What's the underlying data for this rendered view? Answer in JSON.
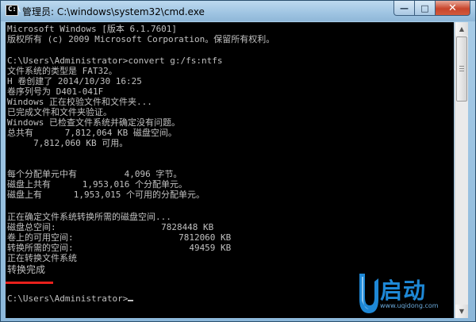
{
  "window": {
    "title": "管理员: C:\\windows\\system32\\cmd.exe",
    "app_icon": "command-prompt-icon",
    "buttons": {
      "minimize": "minimize-icon",
      "maximize": "maximize-icon",
      "close": "close-icon"
    }
  },
  "console": {
    "lines": [
      "Microsoft Windows [版本 6.1.7601]",
      "版权所有 (c) 2009 Microsoft Corporation。保留所有权利。",
      "",
      "C:\\Users\\Administrator>convert g:/fs:ntfs",
      "文件系统的类型是 FAT32。",
      "H 卷创建了 2014/10/30 16:25",
      "卷序列号为 D401-041F",
      "Windows 正在校验文件和文件夹...",
      "已完成文件和文件夹验证。",
      "Windows 已检查文件系统并确定没有问题。",
      "总共有      7,812,064 KB 磁盘空间。",
      "     7,812,060 KB 可用。",
      "",
      "",
      "每个分配单元中有         4,096 字节。",
      "磁盘上共有      1,953,016 个分配单元。",
      "磁盘上有      1,953,015 个可用的分配单元。",
      "",
      "正在确定文件系统转换所需的磁盘空间...",
      "磁盘总空间:                    7828448 KB",
      "卷上的可用空间:                    7812060 KB",
      "转换所需的空间:                      49459 KB",
      "正在转换文件系统",
      "转换完成",
      "",
      "C:\\Users\\Administrator>"
    ]
  },
  "watermark": {
    "brand_cn": "启动",
    "url": "www.uqidong.com",
    "letter": "U"
  },
  "colors": {
    "console_bg": "#000000",
    "console_fg": "#c0c0c0",
    "highlight_underline": "#e8201c",
    "logo_blue": "#1e88d6"
  }
}
